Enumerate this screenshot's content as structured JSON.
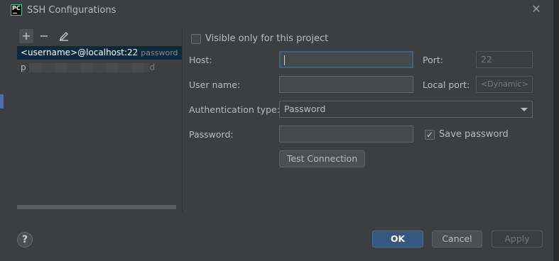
{
  "window": {
    "title": "SSH Configurations",
    "app_icon_text": "PC"
  },
  "toolbar": {
    "add_icon": "plus-icon",
    "remove_icon": "minus-icon",
    "edit_icon": "pencil-icon"
  },
  "configs": [
    {
      "name": "<username>@localhost:22",
      "auth": "password",
      "selected": true
    },
    {
      "name_prefix": "p",
      "name_suffix": "d",
      "obscured": true
    }
  ],
  "form": {
    "visible_only": {
      "label": "Visible only for this project",
      "checked": false
    },
    "host": {
      "label": "Host:",
      "value": ""
    },
    "port": {
      "label": "Port:",
      "placeholder": "22"
    },
    "user": {
      "label": "User name:",
      "value": ""
    },
    "local_port": {
      "label": "Local port:",
      "placeholder": "<Dynamic>"
    },
    "auth_type": {
      "label": "Authentication type:",
      "value": "Password"
    },
    "password": {
      "label": "Password:",
      "value": ""
    },
    "save_password": {
      "label": "Save password",
      "checked": true
    },
    "test_button": "Test Connection"
  },
  "footer": {
    "help": "?",
    "ok": "OK",
    "cancel": "Cancel",
    "apply": "Apply"
  },
  "colors": {
    "background": "#3c3f41",
    "selection": "#0d293e",
    "primary_button": "#365880",
    "focus_border": "#3d6185"
  }
}
